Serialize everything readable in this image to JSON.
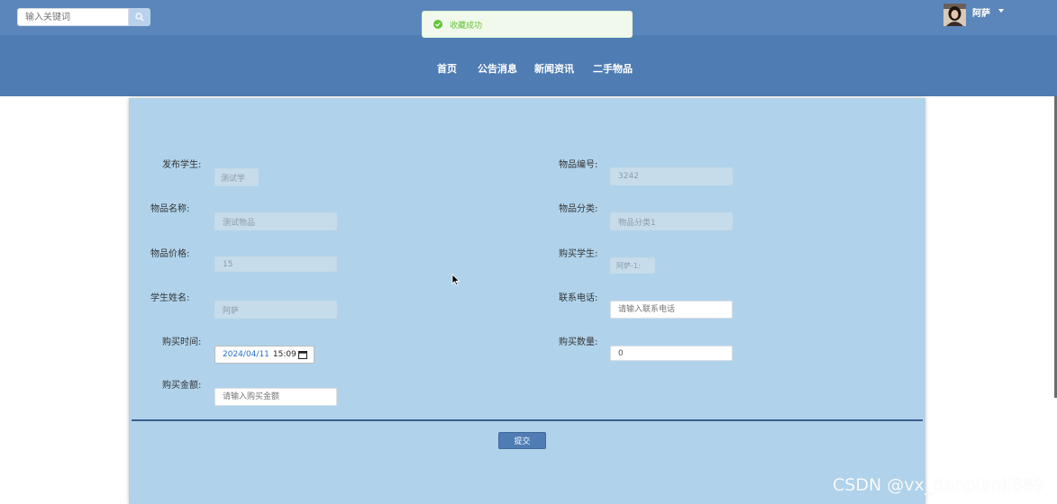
{
  "search": {
    "placeholder": "输入关键词"
  },
  "toast": {
    "message": "收藏成功",
    "color": "#67c23a"
  },
  "user": {
    "name": "阿萨"
  },
  "nav": {
    "items": [
      "首页",
      "公告消息",
      "新闻资讯",
      "二手物品"
    ]
  },
  "form": {
    "publisher": {
      "label": "发布学生:",
      "value": "测试学"
    },
    "item_no": {
      "label": "物品编号:",
      "value": "3242"
    },
    "item_name": {
      "label": "物品名称:",
      "value": "测试物品"
    },
    "item_category": {
      "label": "物品分类:",
      "value": "物品分类1"
    },
    "item_price": {
      "label": "物品价格:",
      "value": "15"
    },
    "buyer": {
      "label": "购买学生:",
      "value": "阿萨-1:"
    },
    "student_name": {
      "label": "学生姓名:",
      "value": "阿萨"
    },
    "phone": {
      "label": "联系电话:",
      "placeholder": "请输入联系电话"
    },
    "purchase_time": {
      "label": "购买时间:",
      "year": "2024",
      "month": "04",
      "day": "11",
      "time": "15:09"
    },
    "quantity": {
      "label": "购买数量:",
      "value": "0"
    },
    "amount": {
      "label": "购买金额:",
      "placeholder": "请输入购买金额"
    },
    "submit_label": "提交"
  },
  "watermark": "CSDN @vx_danpianji889",
  "colors": {
    "topbar": "#5b86bb",
    "navbar": "#4f7cb3",
    "card": "#b0d3eb",
    "success": "#67c23a"
  }
}
